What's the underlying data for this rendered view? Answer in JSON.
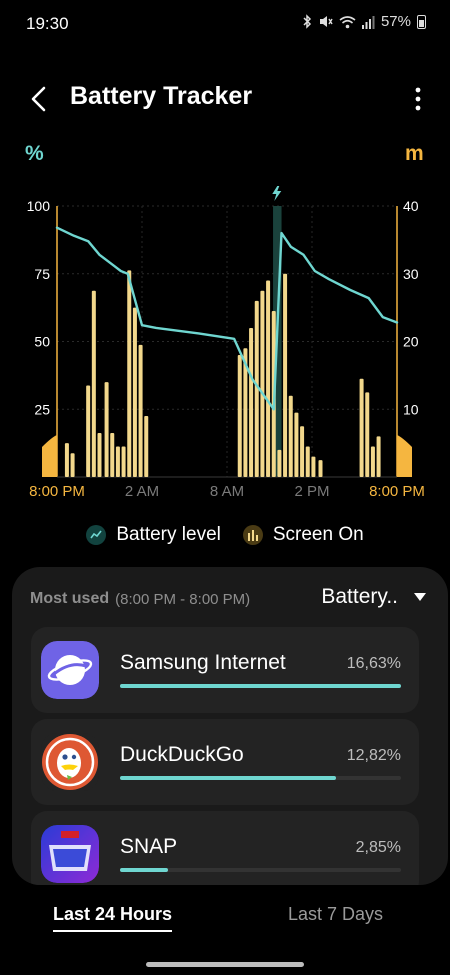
{
  "status_bar": {
    "time": "19:30",
    "battery_percent": "57%",
    "icons": [
      "bluetooth-icon",
      "mute-icon",
      "wifi-icon",
      "signal-icon",
      "battery-icon"
    ]
  },
  "header": {
    "title": "Battery Tracker",
    "back_icon": "chevron-left-icon",
    "more_icon": "more-vertical-icon"
  },
  "chart_data": {
    "type": "bar",
    "left_unit": "%",
    "right_unit": "m",
    "left_ticks": [
      "100",
      "75",
      "50",
      "25"
    ],
    "right_ticks": [
      "40",
      "30",
      "20",
      "10"
    ],
    "ylim_left": [
      0,
      100
    ],
    "ylim_right": [
      0,
      40
    ],
    "x_ticks": [
      {
        "label": "8:00 PM",
        "hour": 0,
        "highlight": true
      },
      {
        "label": "2 AM",
        "hour": 6,
        "highlight": false
      },
      {
        "label": "8 AM",
        "hour": 12,
        "highlight": false
      },
      {
        "label": "2 PM",
        "hour": 18,
        "highlight": false
      },
      {
        "label": "8:00 PM",
        "hour": 24,
        "highlight": true
      }
    ],
    "x_range_hours": [
      0,
      24
    ],
    "charging_window_hours": [
      15.25,
      15.85
    ],
    "charge_marker": "lightning-icon",
    "battery_color": "#6fd6d0",
    "screen_color": "#f2d88c",
    "screen_edge_color": "#f5b640",
    "battery_level": [
      {
        "h": 0.0,
        "v": 92
      },
      {
        "h": 1.2,
        "v": 89
      },
      {
        "h": 2.2,
        "v": 87
      },
      {
        "h": 3.0,
        "v": 82
      },
      {
        "h": 4.0,
        "v": 78
      },
      {
        "h": 4.5,
        "v": 76
      },
      {
        "h": 5.0,
        "v": 75
      },
      {
        "h": 6.0,
        "v": 56
      },
      {
        "h": 7.0,
        "v": 55
      },
      {
        "h": 10.0,
        "v": 53
      },
      {
        "h": 12.5,
        "v": 51
      },
      {
        "h": 13.8,
        "v": 36
      },
      {
        "h": 15.3,
        "v": 25
      },
      {
        "h": 15.85,
        "v": 90
      },
      {
        "h": 16.5,
        "v": 85
      },
      {
        "h": 17.4,
        "v": 82
      },
      {
        "h": 18.2,
        "v": 76
      },
      {
        "h": 19.2,
        "v": 73
      },
      {
        "h": 20.7,
        "v": 69
      },
      {
        "h": 22.0,
        "v": 66
      },
      {
        "h": 23.0,
        "v": 59
      },
      {
        "h": 24.0,
        "v": 57
      }
    ],
    "screen_on_minutes": [
      {
        "h": 0.7,
        "v": 5
      },
      {
        "h": 1.1,
        "v": 3.5
      },
      {
        "h": 2.2,
        "v": 13.5
      },
      {
        "h": 2.6,
        "v": 27.5
      },
      {
        "h": 3.0,
        "v": 6.5
      },
      {
        "h": 3.5,
        "v": 14
      },
      {
        "h": 3.9,
        "v": 6.5
      },
      {
        "h": 4.3,
        "v": 4.5
      },
      {
        "h": 4.7,
        "v": 4.5
      },
      {
        "h": 5.1,
        "v": 30.5
      },
      {
        "h": 5.5,
        "v": 25
      },
      {
        "h": 5.9,
        "v": 19.5
      },
      {
        "h": 6.3,
        "v": 9
      },
      {
        "h": 12.9,
        "v": 18
      },
      {
        "h": 13.3,
        "v": 19
      },
      {
        "h": 13.7,
        "v": 22
      },
      {
        "h": 14.1,
        "v": 26
      },
      {
        "h": 14.5,
        "v": 27.5
      },
      {
        "h": 14.9,
        "v": 29
      },
      {
        "h": 15.3,
        "v": 24.5
      },
      {
        "h": 15.7,
        "v": 4
      },
      {
        "h": 16.1,
        "v": 30
      },
      {
        "h": 16.5,
        "v": 12
      },
      {
        "h": 16.9,
        "v": 9.5
      },
      {
        "h": 17.3,
        "v": 7.5
      },
      {
        "h": 17.7,
        "v": 4.5
      },
      {
        "h": 18.1,
        "v": 3
      },
      {
        "h": 18.6,
        "v": 2.5
      },
      {
        "h": 21.5,
        "v": 14.5
      },
      {
        "h": 21.9,
        "v": 12.5
      },
      {
        "h": 22.3,
        "v": 4.5
      },
      {
        "h": 22.7,
        "v": 6
      }
    ]
  },
  "legend": {
    "battery_label": "Battery level",
    "screen_label": "Screen On"
  },
  "most_used": {
    "label": "Most used",
    "range": "(8:00 PM - 8:00 PM)",
    "sort_value": "Battery..",
    "apps": [
      {
        "name": "Samsung Internet",
        "percent_text": "16,63%",
        "bar_fraction": 1.0
      },
      {
        "name": "DuckDuckGo",
        "percent_text": "12,82%",
        "bar_fraction": 0.77
      },
      {
        "name": "SNAP",
        "percent_text": "2,85%",
        "bar_fraction": 0.17
      }
    ]
  },
  "tabs": [
    {
      "label": "Last 24 Hours",
      "selected": true
    },
    {
      "label": "Last 7 Days",
      "selected": false
    }
  ]
}
